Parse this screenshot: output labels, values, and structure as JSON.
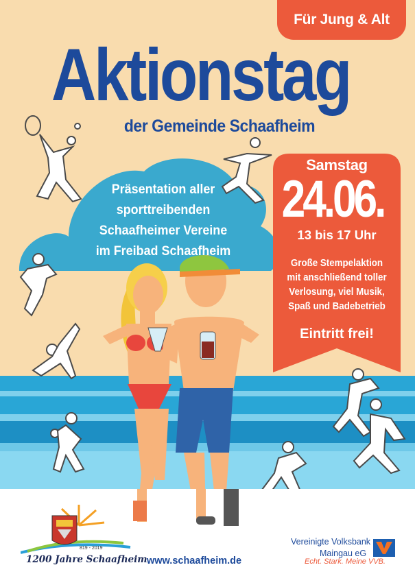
{
  "badge": "Für Jung & Alt",
  "title": "Aktionstag",
  "subtitle": "der Gemeinde Schaafheim",
  "cloud_text": [
    "Präsentation aller",
    "sporttreibenden",
    "Schaafheimer Vereine",
    "im Freibad Schaafheim"
  ],
  "banner": {
    "day": "Samstag",
    "date": "24.06.",
    "time": "13 bis 17 Uhr",
    "info": [
      "Große Stempelaktion",
      "mit anschließend toller",
      "Verlosung, viel Musik,",
      "Spaß und Badebetrieb"
    ],
    "free": "Eintritt frei!"
  },
  "footer": {
    "jubilee": "1200 Jahre Schaafheim",
    "jubilee_years": "819 - 2019",
    "url": "www.schaafheim.de",
    "bank_line1": "Vereinigte Volksbank",
    "bank_line2": "Maingau eG",
    "bank_slogan": "Echt. Stark. Meine VVB."
  },
  "colors": {
    "background": "#f9dcae",
    "title_blue": "#1d4a9b",
    "accent_red": "#ec5a3b",
    "cloud": "#3aa9ce",
    "sea": "#29a6d6"
  },
  "icons": [
    "tennis-player-icon",
    "runner-icon",
    "volleyball-player-icon",
    "gymnast-icon",
    "handball-player-icon",
    "basketball-player-icon",
    "runner-right-icon",
    "soccer-player-icon",
    "swimmer-icon",
    "municipal-crest-icon",
    "volksbank-logo-icon"
  ]
}
